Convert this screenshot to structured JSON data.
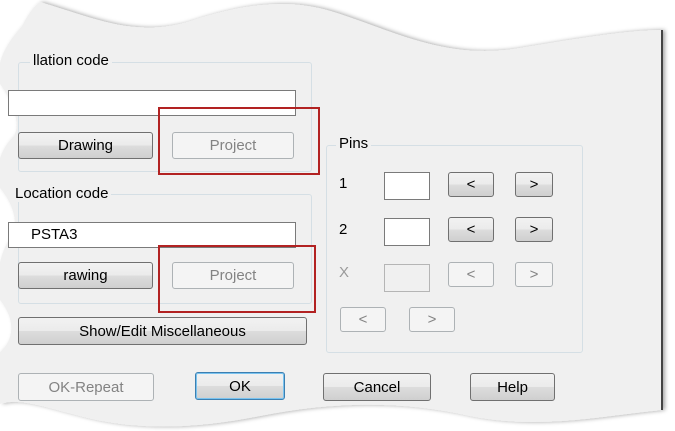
{
  "installation_group": {
    "label": "llation code",
    "value": "",
    "drawing_button": "Drawing",
    "project_button": "Project"
  },
  "location_group": {
    "label": "Location code",
    "value": "PSTA3",
    "drawing_button": "rawing",
    "project_button": "Project"
  },
  "misc_button": "Show/Edit Miscellaneous",
  "pins": {
    "label": "Pins",
    "rows": [
      {
        "number": "1",
        "prev": "<",
        "next": ">",
        "enabled": true
      },
      {
        "number": "2",
        "prev": "<",
        "next": ">",
        "enabled": true
      },
      {
        "number": "X",
        "prev": "<",
        "next": ">",
        "enabled": false
      }
    ],
    "nav_prev": "<",
    "nav_next": ">"
  },
  "footer": {
    "ok_repeat": "OK-Repeat",
    "ok": "OK",
    "cancel": "Cancel",
    "help": "Help"
  },
  "colors": {
    "dialog_bg": "#f0f0f0",
    "highlight": "#b22222"
  }
}
